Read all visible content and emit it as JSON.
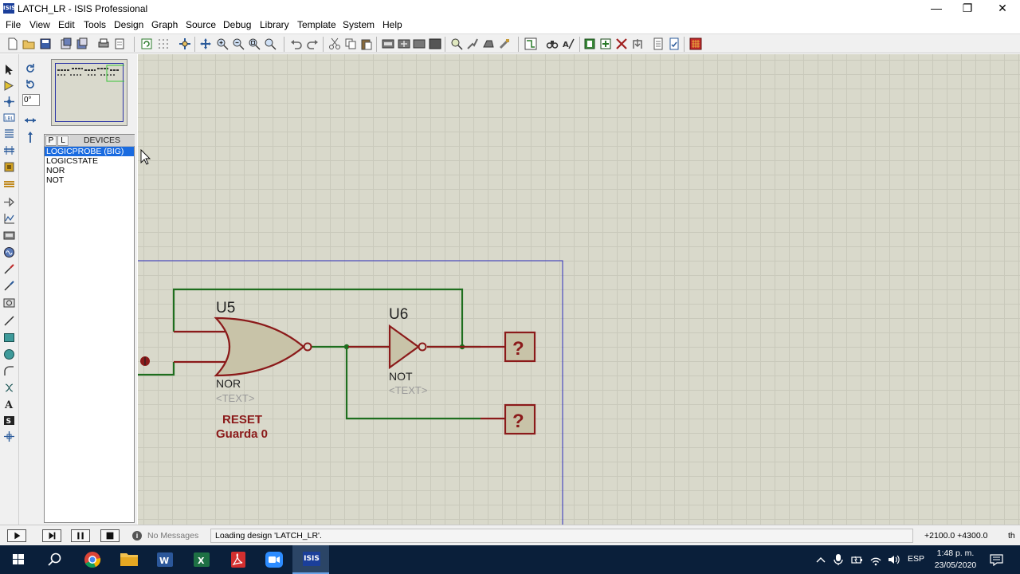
{
  "window": {
    "title": "LATCH_LR - ISIS Professional",
    "app_icon_text": "ISIS",
    "minimize_glyph": "—",
    "maximize_glyph": "❐",
    "close_glyph": "✕"
  },
  "menu": [
    "File",
    "View",
    "Edit",
    "Tools",
    "Design",
    "Graph",
    "Source",
    "Debug",
    "Library",
    "Template",
    "System",
    "Help"
  ],
  "sidepanel": {
    "angle_value": "0°",
    "tab_p": "P",
    "tab_l": "L",
    "devices_header": "DEVICES",
    "devices": [
      "LOGICPROBE (BIG)",
      "LOGICSTATE",
      "NOR",
      "NOT"
    ],
    "selected_device_index": 0
  },
  "schematic": {
    "u5_ref": "U5",
    "u5_type": "NOR",
    "u5_text": "<TEXT>",
    "u6_ref": "U6",
    "u6_type": "NOT",
    "u6_text": "<TEXT>",
    "probe1_value": "?",
    "probe2_value": "?",
    "note_line1": "RESET",
    "note_line2": "Guarda 0",
    "colors": {
      "wire": "#1e6e1e",
      "component": "#8b1a1a",
      "component_fill": "#c8c3a8",
      "text_grey": "#9a9a9a",
      "sheet_border": "#2d2dbd"
    }
  },
  "statusbar": {
    "messages": "No Messages",
    "status": "Loading design 'LATCH_LR'.",
    "coords": "+2100.0   +4300.0",
    "unit": "th"
  },
  "taskbar": {
    "language": "ESP",
    "time": "1:48 p. m.",
    "date": "23/05/2020",
    "isis_label": "ISIS"
  }
}
